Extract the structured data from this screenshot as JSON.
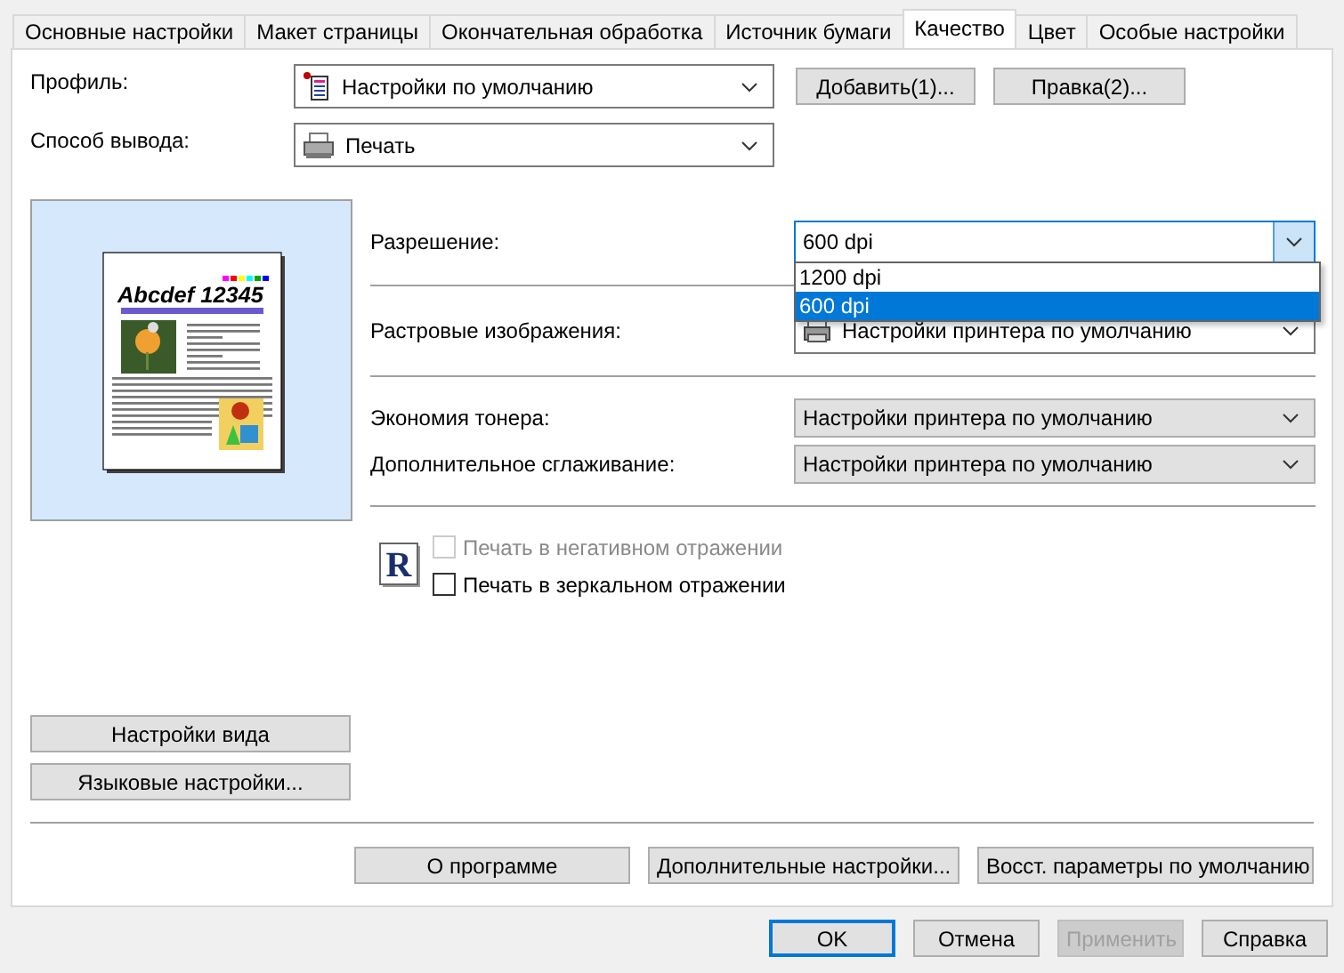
{
  "tabs": [
    {
      "label": "Основные настройки",
      "selected": false
    },
    {
      "label": "Макет страницы",
      "selected": false
    },
    {
      "label": "Окончательная обработка",
      "selected": false
    },
    {
      "label": "Источник бумаги",
      "selected": false
    },
    {
      "label": "Качество",
      "selected": true
    },
    {
      "label": "Цвет",
      "selected": false
    },
    {
      "label": "Особые настройки",
      "selected": false
    }
  ],
  "profile": {
    "label": "Профиль:",
    "value": "Настройки по умолчанию"
  },
  "profile_buttons": [
    "Добавить(1)...",
    "Правка(2)..."
  ],
  "output": {
    "label": "Способ вывода:",
    "value": "Печать"
  },
  "preview": {
    "heading": "Abcdef 12345"
  },
  "left_buttons": [
    "Настройки вида",
    "Языковые настройки..."
  ],
  "groups": [
    [
      {
        "kind": "open-combo",
        "label": "Разрешение:",
        "value": "600 dpi",
        "options": [
          {
            "label": "1200 dpi",
            "selected": false
          },
          {
            "label": "600 dpi",
            "selected": true
          }
        ]
      }
    ],
    [
      {
        "kind": "icon-combo",
        "label": "Растровые изображения:",
        "value": "Настройки принтера по умолчанию"
      }
    ],
    [
      {
        "kind": "combo",
        "label": "Экономия тонера:",
        "value": "Настройки принтера по умолчанию"
      },
      {
        "kind": "combo",
        "label": "Дополнительное сглаживание:",
        "value": "Настройки принтера по умолчанию"
      }
    ]
  ],
  "print_icon_letter": "R",
  "checkboxes": [
    {
      "label": "Печать в негативном отражении",
      "checked": false,
      "disabled": true
    },
    {
      "label": "Печать в зеркальном отражении",
      "checked": false,
      "disabled": false
    }
  ],
  "bottom_buttons": [
    "О программе",
    "Дополнительные настройки...",
    "Восст. параметры по умолчанию"
  ],
  "dialog_buttons": [
    {
      "label": "OK",
      "default": true,
      "disabled": false
    },
    {
      "label": "Отмена",
      "default": false,
      "disabled": false
    },
    {
      "label": "Применить",
      "default": false,
      "disabled": true
    },
    {
      "label": "Справка",
      "default": false,
      "disabled": false
    }
  ]
}
